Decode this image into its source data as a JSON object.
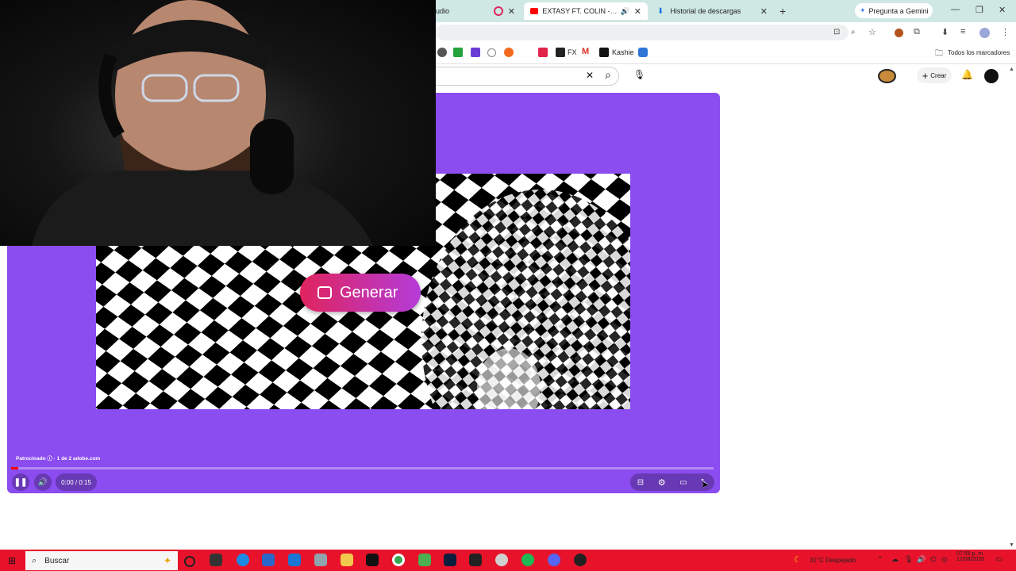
{
  "browser": {
    "tabs": [
      {
        "title": "Studio",
        "partial": "udio"
      },
      {
        "title": "EXTASY FT. COLIN - VISUAL"
      },
      {
        "title": "Historial de descargas"
      }
    ],
    "new_tab": "+",
    "gemini_label": "Pregunta a Gemini",
    "bookmarks": [
      "FX",
      "Kashie"
    ],
    "all_bookmarks_label": "Todos los marcadores"
  },
  "youtube": {
    "create_label": "Crear"
  },
  "player": {
    "ad_button_label": "Generar",
    "ad_info": "Patrocinado ⓘ · 1 de 2    adobe.com",
    "time": "0:00 / 0:15",
    "progress": 0.01
  },
  "taskbar": {
    "search_label": "Buscar",
    "weather": "31°C  Despejado",
    "time": "07:55 p. m.",
    "date": "12/08/2026"
  },
  "colors": {
    "player_bg": "#8b4cf0",
    "taskbar_bg": "#e8132b",
    "tabstrip_bg": "#cfe8e4"
  }
}
